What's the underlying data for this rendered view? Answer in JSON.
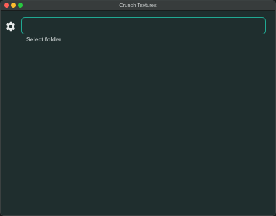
{
  "window": {
    "title": "Crunch Textures"
  },
  "toolbar": {
    "settings_icon": "gear-icon",
    "folder_input": {
      "value": "",
      "placeholder": ""
    },
    "select_folder_label": "Select folder"
  },
  "colors": {
    "background": "#1f2e2e",
    "accent": "#20a892",
    "titlebar": "#373c3c",
    "label": "#a9b1b1"
  }
}
